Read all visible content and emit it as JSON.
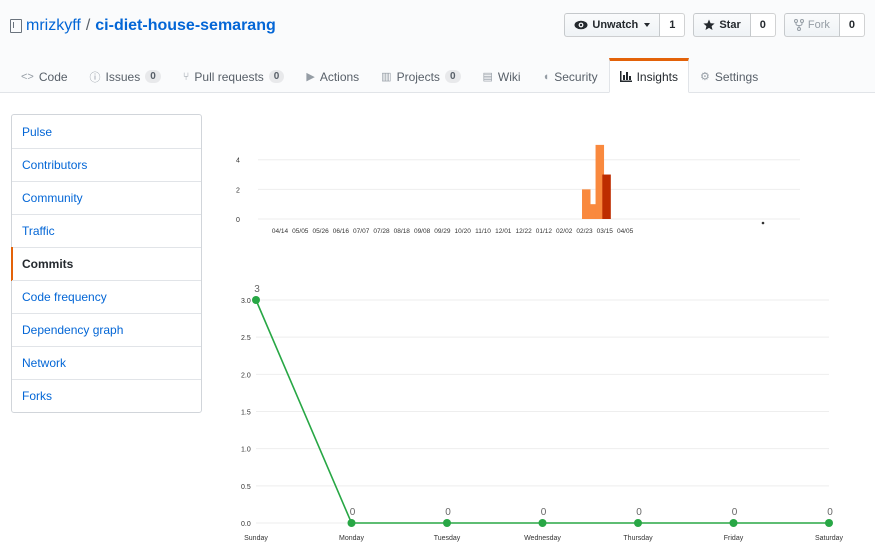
{
  "repo": {
    "owner": "mrizkyff",
    "separator": "/",
    "name": "ci-diet-house-semarang"
  },
  "actions": [
    {
      "label": "Unwatch",
      "count": "1",
      "icon": "eye-icon"
    },
    {
      "label": "Star",
      "count": "0",
      "icon": "star-icon"
    },
    {
      "label": "Fork",
      "count": "0",
      "icon": "fork-icon"
    }
  ],
  "tabs": [
    {
      "label": "Code",
      "icon": "code-icon"
    },
    {
      "label": "Issues",
      "count": "0",
      "icon": "issue-icon"
    },
    {
      "label": "Pull requests",
      "count": "0",
      "icon": "pull-request-icon"
    },
    {
      "label": "Actions",
      "icon": "play-icon"
    },
    {
      "label": "Projects",
      "count": "0",
      "icon": "project-icon"
    },
    {
      "label": "Wiki",
      "icon": "book-icon"
    },
    {
      "label": "Security",
      "icon": "shield-icon"
    },
    {
      "label": "Insights",
      "icon": "graph-icon",
      "selected": true
    },
    {
      "label": "Settings",
      "icon": "gear-icon"
    }
  ],
  "sidebar": {
    "items": [
      "Pulse",
      "Contributors",
      "Community",
      "Traffic",
      "Commits",
      "Code frequency",
      "Dependency graph",
      "Network",
      "Forks"
    ],
    "selected": "Commits"
  },
  "colors": {
    "accent": "#e36209",
    "link": "#0366d6",
    "bar_orange": "#f9893e",
    "bar_red": "#bd2c00",
    "line_green": "#28a745"
  },
  "chart_data": [
    {
      "type": "bar",
      "y_ticks": [
        "0",
        "2",
        "4"
      ],
      "ylim": [
        0,
        5.6
      ],
      "x_tick_labels": [
        "04/14",
        "05/05",
        "05/26",
        "06/16",
        "07/07",
        "07/28",
        "08/18",
        "09/08",
        "09/29",
        "10/20",
        "11/10",
        "12/01",
        "12/22",
        "01/12",
        "02/02",
        "02/23",
        "03/15",
        "04/05"
      ],
      "bars": [
        {
          "week": "03/01",
          "value": 2,
          "color": "#f9893e"
        },
        {
          "week": "03/08",
          "value": 1,
          "color": "#f9893e"
        },
        {
          "week": "03/15",
          "value": 5,
          "color": "#f9893e"
        },
        {
          "week": "03/22",
          "value": 3,
          "color": "#bd2c00"
        }
      ],
      "grid": true
    },
    {
      "type": "line",
      "categories": [
        "Sunday",
        "Monday",
        "Tuesday",
        "Wednesday",
        "Thursday",
        "Friday",
        "Saturday"
      ],
      "values": [
        3,
        0,
        0,
        0,
        0,
        0,
        0
      ],
      "value_labels": [
        "3",
        "0",
        "0",
        "0",
        "0",
        "0",
        "0"
      ],
      "y_ticks": [
        "0.0",
        "0.5",
        "1.0",
        "1.5",
        "2.0",
        "2.5",
        "3.0"
      ],
      "ylim": [
        0,
        3
      ],
      "grid": true
    }
  ]
}
